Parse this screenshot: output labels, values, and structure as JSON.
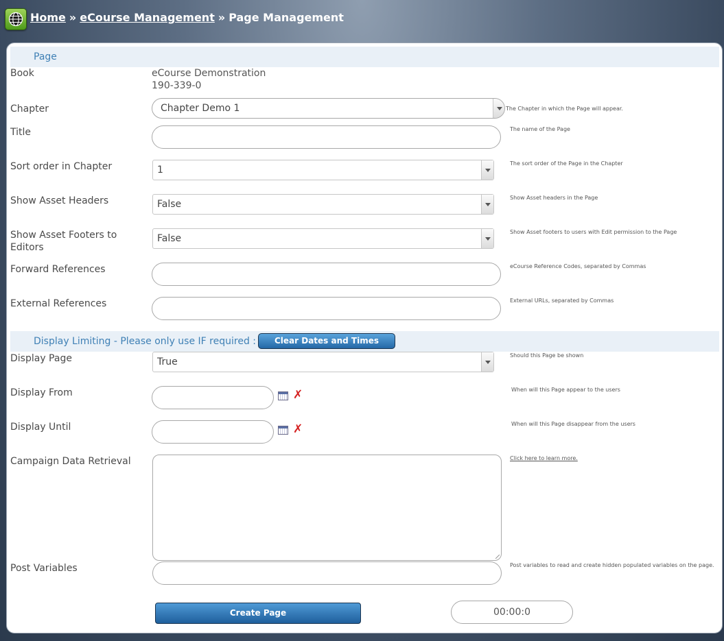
{
  "breadcrumb": {
    "home": "Home",
    "sep1": "»",
    "ecourse": "eCourse Management",
    "sep2": "»",
    "current": "Page Management"
  },
  "section_page": "Page",
  "book": {
    "label": "Book",
    "name": "eCourse Demonstration",
    "code": "190-339-0"
  },
  "chapter": {
    "label": "Chapter",
    "value": "Chapter Demo 1",
    "help": "The Chapter in which the Page will appear."
  },
  "title_field": {
    "label": "Title",
    "value": "",
    "help": "The name of the Page"
  },
  "sort_order": {
    "label": "Sort order in Chapter",
    "value": "1",
    "help": "The sort order of the Page in the Chapter"
  },
  "show_headers": {
    "label": "Show Asset Headers",
    "value": "False",
    "help": "Show Asset headers in the Page"
  },
  "show_footers": {
    "label_line1": "Show Asset Footers to",
    "label_line2": "Editors",
    "value": "False",
    "help": "Show Asset footers to users with Edit permission to the Page"
  },
  "forward_refs": {
    "label": "Forward References",
    "value": "",
    "help": "eCourse Reference Codes, separated by Commas"
  },
  "external_refs": {
    "label": "External References",
    "value": "",
    "help": "External URLs, separated by Commas"
  },
  "section_display": "Display Limiting - Please only use IF required :",
  "clear_button": "Clear Dates and Times",
  "display_page": {
    "label": "Display Page",
    "value": "True",
    "help": "Should this Page be shown"
  },
  "display_from": {
    "label": "Display From",
    "value": "",
    "help": "When will this Page appear to the users"
  },
  "display_until": {
    "label": "Display Until",
    "value": "",
    "help": "When will this Page disappear from the users"
  },
  "campaign": {
    "label": "Campaign Data Retrieval",
    "value": "",
    "help": "Click here to learn more."
  },
  "post_vars": {
    "label": "Post Variables",
    "value": "",
    "help": "Post variables to read and create hidden populated variables on the page."
  },
  "create_button": "Create Page",
  "timer": "00:00:0",
  "icons": {
    "app": "globe-icon",
    "calendar": "calendar-icon",
    "clear": "red-x-icon"
  }
}
